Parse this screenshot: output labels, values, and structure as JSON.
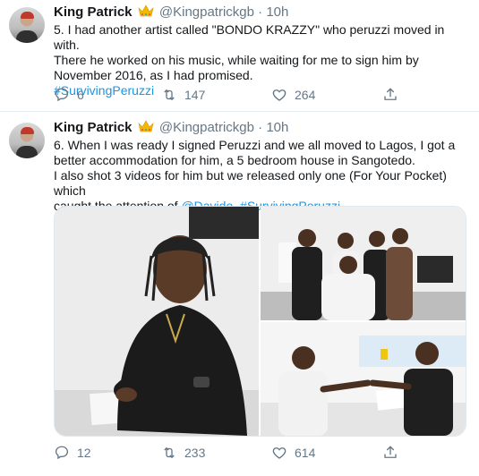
{
  "tweets": [
    {
      "author_name": "King Patrick",
      "handle": "@Kingpatrickgb",
      "separator": "·",
      "time": "10h",
      "lines": [
        "5. I had another artist called \"BONDO KRAZZY\" who peruzzi moved in with.",
        "There he worked on his music, while waiting for me to sign him by",
        "November 2016, as I had promised."
      ],
      "hashtag": "#SurvivingPeruzzi",
      "counts": {
        "replies": "6",
        "retweets": "147",
        "likes": "264"
      }
    },
    {
      "author_name": "King Patrick",
      "handle": "@Kingpatrickgb",
      "separator": "·",
      "time": "10h",
      "lines": [
        "6. When I was ready I signed Peruzzi and we all moved to Lagos, I got a",
        "better accommodation for him, a 5 bedroom house in Sangotedo.",
        "I also shot 3 videos for him but we released only one (For Your Pocket) which",
        "caught the attention of "
      ],
      "mention": "@Davido",
      "after_mention": ". ",
      "hashtag": "#SurvivingPeruzzi",
      "counts": {
        "replies": "12",
        "retweets": "233",
        "likes": "614"
      }
    }
  ],
  "icons": {
    "reply": "speech-bubble-icon",
    "retweet": "retweet-icon",
    "like": "heart-icon",
    "share": "share-icon",
    "badge": "crown-emoji-icon"
  },
  "colors": {
    "link": "#1b95e0",
    "muted": "#657786",
    "crown": "#f5b800"
  }
}
